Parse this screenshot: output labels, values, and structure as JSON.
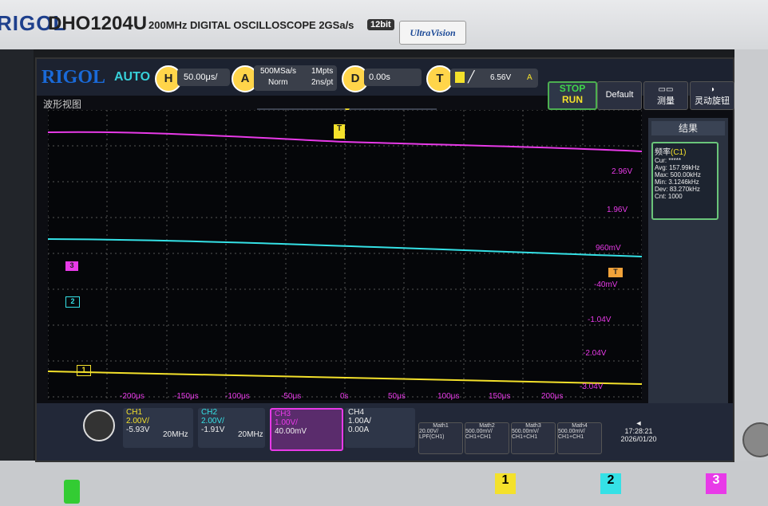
{
  "bezel": {
    "brand": "RIGOL",
    "model": "DHO1204U",
    "desc": "200MHz DIGITAL OSCILLOSCOPE 2GSa/s",
    "bits": "12bit",
    "uv": "UltraVision"
  },
  "status": {
    "logo": "RIGOL",
    "mode": "AUTO",
    "h_label": "H",
    "h_value": "50.00μs/",
    "a_label": "A",
    "sample_rate": "500MSa/s",
    "mem": "1Mpts",
    "acq": "Norm",
    "pts": "2ns/pt",
    "d_label": "D",
    "delay": "0.00s",
    "t_label": "T",
    "trig_level": "6.56V",
    "trig_src": "A",
    "stop": "STOP",
    "run": "RUN",
    "default": "Default",
    "measure": "测量",
    "trigger": "灵动旋钮"
  },
  "tabs": {
    "waveform": "波形视图"
  },
  "markers": {
    "trigger": "T"
  },
  "right_labels": [
    "2.96V",
    "1.96V",
    "960mV",
    "-40mV",
    "-1.04V",
    "-2.04V",
    "-3.04V"
  ],
  "x_labels": [
    "-200μs",
    "-150μs",
    "-100μs",
    "-50μs",
    "0s",
    "50μs",
    "100μs",
    "150μs",
    "200μs"
  ],
  "channel_markers": {
    "ch3": "3",
    "ch2": "2",
    "ch1": "1"
  },
  "result": {
    "title": "结果",
    "name": "频率",
    "src": "(C1)",
    "rows": [
      [
        "Cur:",
        "*****"
      ],
      [
        "Avg:",
        "157.99kHz"
      ],
      [
        "Max:",
        "500.00kHz"
      ],
      [
        "Min:",
        "3.1246kHz"
      ],
      [
        "Dev:",
        "83.270kHz"
      ],
      [
        "Cnt:",
        "1000"
      ]
    ]
  },
  "channels": [
    {
      "name": "CH1",
      "scale": "2.00V/",
      "offset": "-5.93V",
      "bw": "20MHz",
      "color": "#f4e12b"
    },
    {
      "name": "CH2",
      "scale": "2.00V/",
      "offset": "-1.91V",
      "bw": "20MHz",
      "color": "#35e1e6"
    },
    {
      "name": "CH3",
      "scale": "1.00V/",
      "offset": "40.00mV",
      "bw": "",
      "color": "#e83ae8"
    },
    {
      "name": "CH4",
      "scale": "1.00A/",
      "offset": "0.00A",
      "bw": "",
      "color": "#9aa0a8"
    }
  ],
  "math": [
    {
      "name": "Math1",
      "l1": "20.00V/",
      "l2": "LPF(CH1)"
    },
    {
      "name": "Math2",
      "l1": "500.00mV/",
      "l2": "CH1+CH1"
    },
    {
      "name": "Math3",
      "l1": "500.00mV/",
      "l2": "CH1+CH1"
    },
    {
      "name": "Math4",
      "l1": "500.00mV/",
      "l2": "CH1+CH1"
    }
  ],
  "clock": {
    "time": "17:28:21",
    "date": "2026/01/20"
  },
  "bottom_labels": [
    "1",
    "2",
    "3"
  ],
  "colors": {
    "ch1": "#f4e12b",
    "ch2": "#35e1e6",
    "ch3": "#e83ae8",
    "trigger": "#f2a33a"
  }
}
